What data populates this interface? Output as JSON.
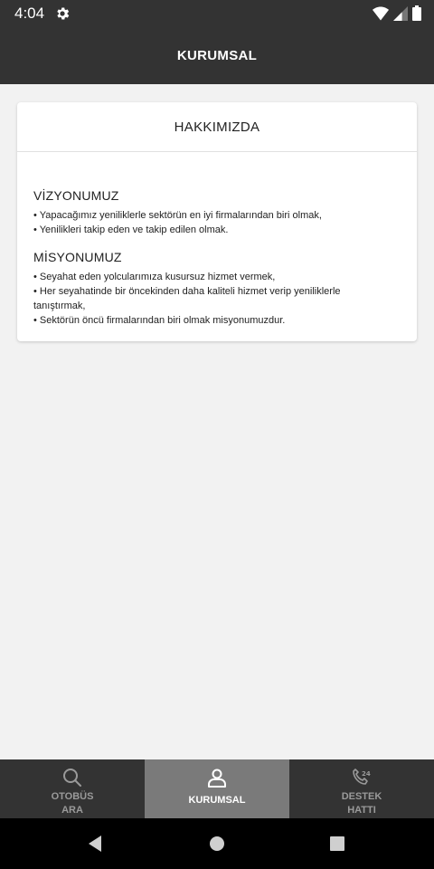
{
  "status_bar": {
    "time": "4:04"
  },
  "app_bar": {
    "title": "KURUMSAL"
  },
  "card": {
    "title": "HAKKIMIZDA",
    "vision": {
      "heading": "VİZYONUMUZ",
      "lines": [
        "• Yapacağımız yeniliklerle sektörün en iyi firmalarından biri olmak,",
        "• Yenilikleri takip eden ve takip edilen olmak."
      ]
    },
    "mission": {
      "heading": "MİSYONUMUZ",
      "lines": [
        "• Seyahat eden yolcularımıza kusursuz hizmet vermek,",
        "• Her seyahatinde bir öncekinden daha kaliteli hizmet verip yeniliklerle",
        "tanıştırmak,",
        "• Sektörün öncü firmalarından biri olmak misyonumuzdur."
      ]
    }
  },
  "bottom_nav": {
    "items": [
      {
        "line1": "OTOBÜS",
        "line2": "ARA",
        "icon": "search-icon"
      },
      {
        "line1": "KURUMSAL",
        "line2": "",
        "icon": "user-icon"
      },
      {
        "line1": "DESTEK",
        "line2": "HATTI",
        "icon": "support-24-icon"
      }
    ],
    "active_index": 1
  }
}
